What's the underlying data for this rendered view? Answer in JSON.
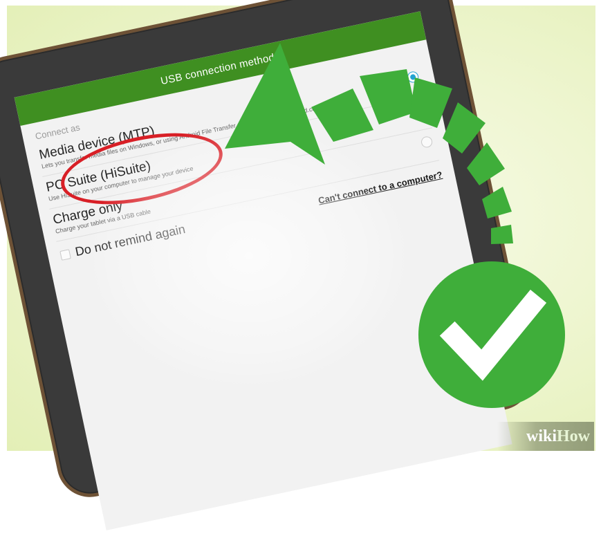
{
  "dialog": {
    "title": "USB connection methods",
    "section_label": "Connect as",
    "options": [
      {
        "title": "Media device (MTP)",
        "desc": "Lets you transfer media files on Windows, or using Android File Transfer on Mac (see www.android.com/filetransfer)",
        "selected": true
      },
      {
        "title": "PC Suite (HiSuite)",
        "desc": "Use HiSuite on your computer to manage your device",
        "selected": false
      },
      {
        "title": "Charge only",
        "desc": "Charge your tablet via a USB cable",
        "selected": false
      }
    ],
    "remind_label": "Do not remind again",
    "help_link": "Can't connect to a computer?"
  },
  "icons": {
    "arrow": "curved-arrow-icon",
    "check": "checkmark-icon",
    "highlight": "red-ellipse-highlight"
  },
  "colors": {
    "accent_green": "#3f8f21",
    "arrow_green": "#3fae3a",
    "highlight_red": "#d81f26",
    "radio_blue": "#23a3d1"
  },
  "logo": {
    "part1": "wiki",
    "part2": "How"
  }
}
